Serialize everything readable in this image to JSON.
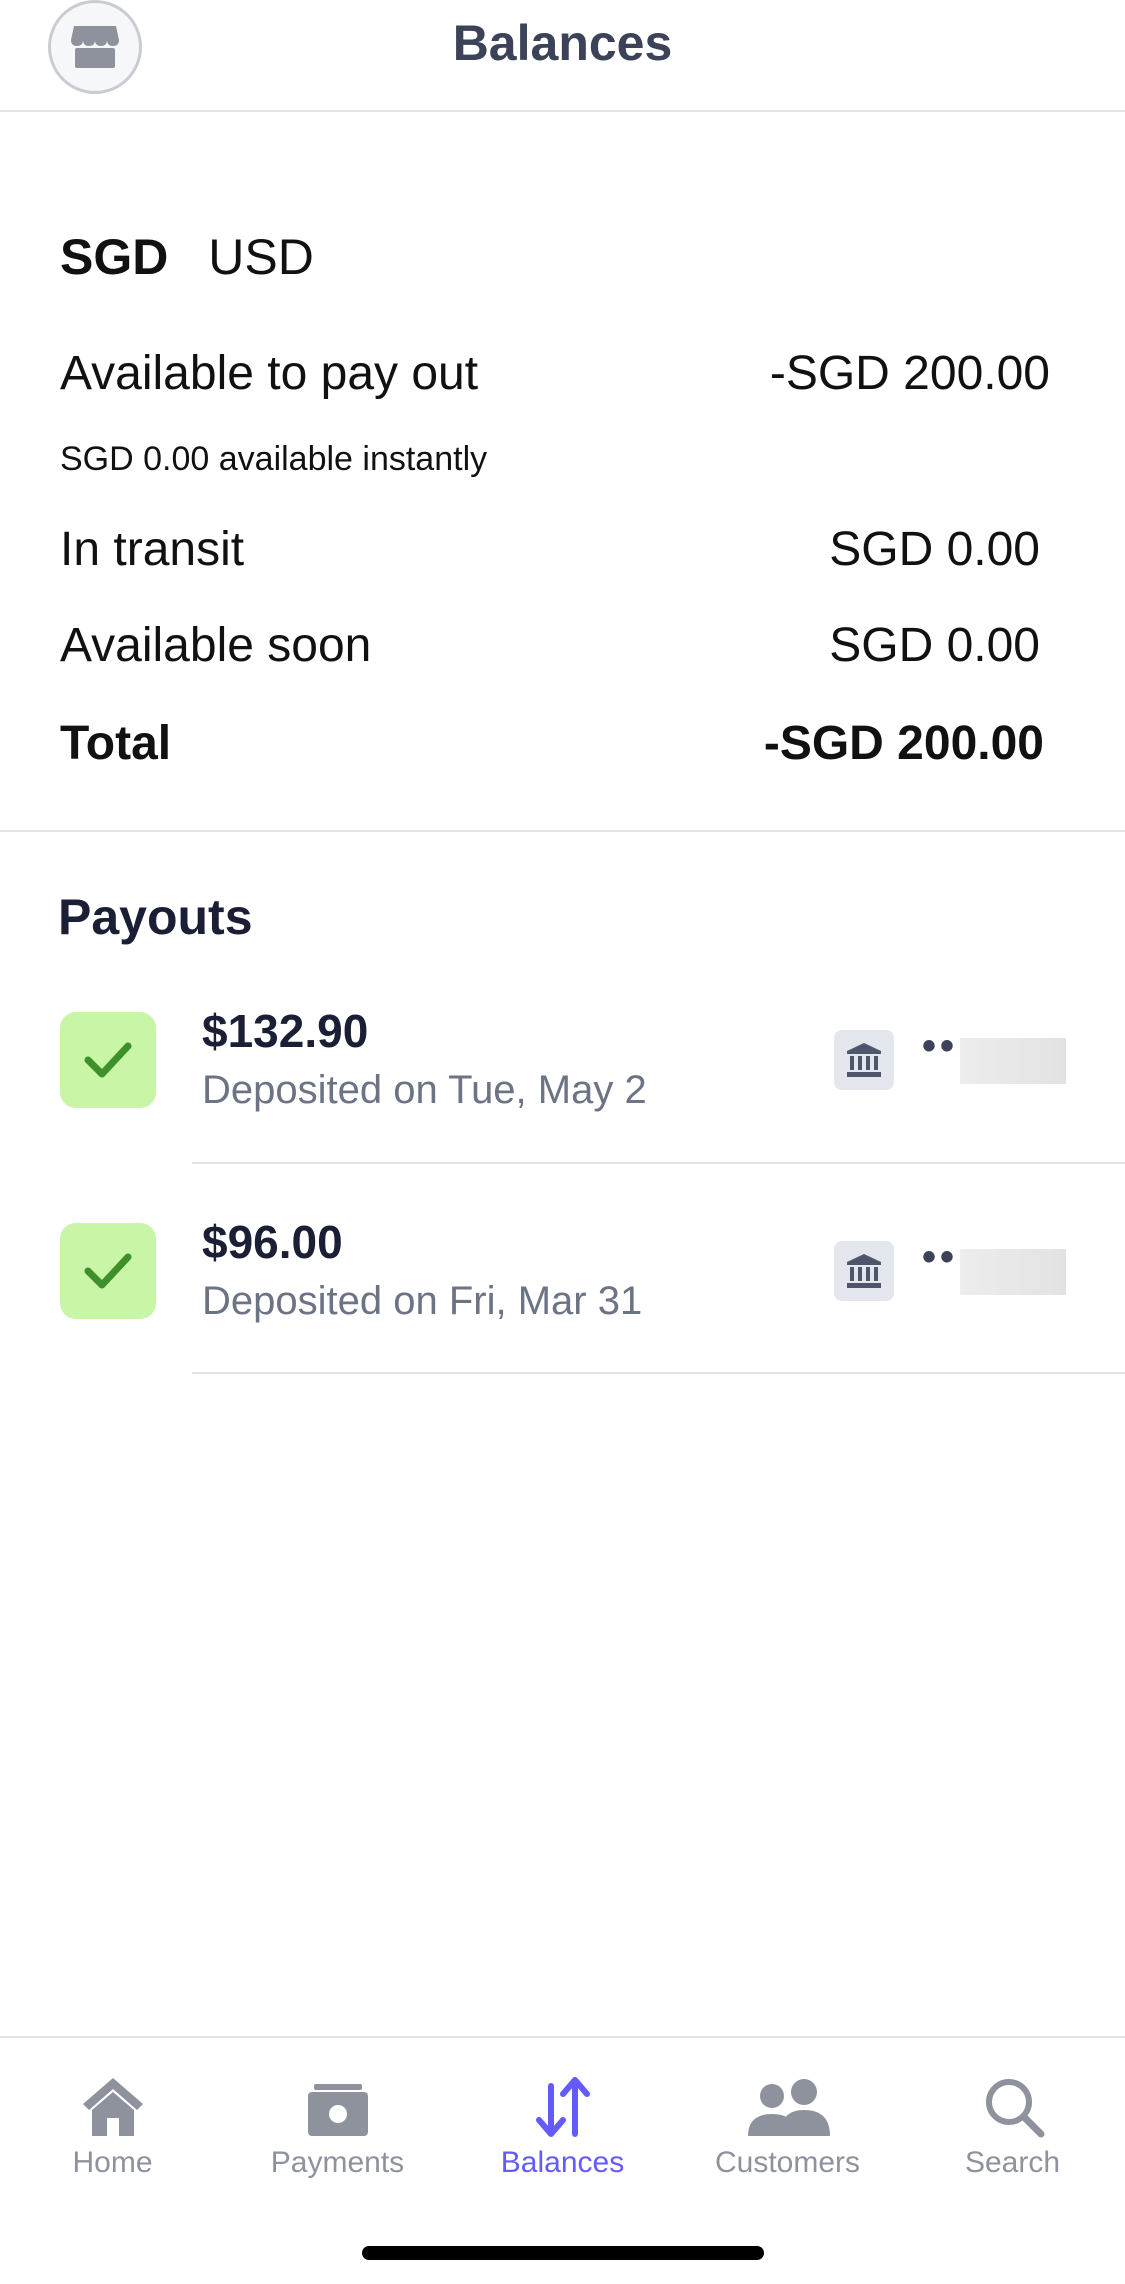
{
  "header": {
    "title": "Balances",
    "store_icon": "store-icon"
  },
  "balances": {
    "currencies": [
      {
        "label": "SGD",
        "active": true
      },
      {
        "label": "USD",
        "active": false
      }
    ],
    "available_to_pay_out": {
      "label": "Available to pay out",
      "value": "-SGD 200.00"
    },
    "instant_note": "SGD 0.00 available instantly",
    "in_transit": {
      "label": "In transit",
      "value": "SGD 0.00"
    },
    "available_soon": {
      "label": "Available soon",
      "value": "SGD 0.00"
    },
    "total": {
      "label": "Total",
      "value": "-SGD 200.00"
    }
  },
  "payouts": {
    "title": "Payouts",
    "items": [
      {
        "amount": "$132.90",
        "date": "Deposited on Tue, May 2",
        "account_dots": "••",
        "status_icon": "check-icon",
        "bank_icon": "bank-icon"
      },
      {
        "amount": "$96.00",
        "date": "Deposited on Fri, Mar 31",
        "account_dots": "••",
        "status_icon": "check-icon",
        "bank_icon": "bank-icon"
      }
    ]
  },
  "tabbar": {
    "items": [
      {
        "label": "Home",
        "icon": "home-icon",
        "active": false
      },
      {
        "label": "Payments",
        "icon": "payments-icon",
        "active": false
      },
      {
        "label": "Balances",
        "icon": "balances-icon",
        "active": true
      },
      {
        "label": "Customers",
        "icon": "customers-icon",
        "active": false
      },
      {
        "label": "Search",
        "icon": "search-icon",
        "active": false
      }
    ]
  },
  "colors": {
    "accent": "#635bff",
    "inactive_tab": "#8d929d",
    "success_bg": "#c8f5a6",
    "success_check": "#3f8f2a",
    "muted_text": "#6b7385",
    "divider": "#e3e4e8"
  }
}
